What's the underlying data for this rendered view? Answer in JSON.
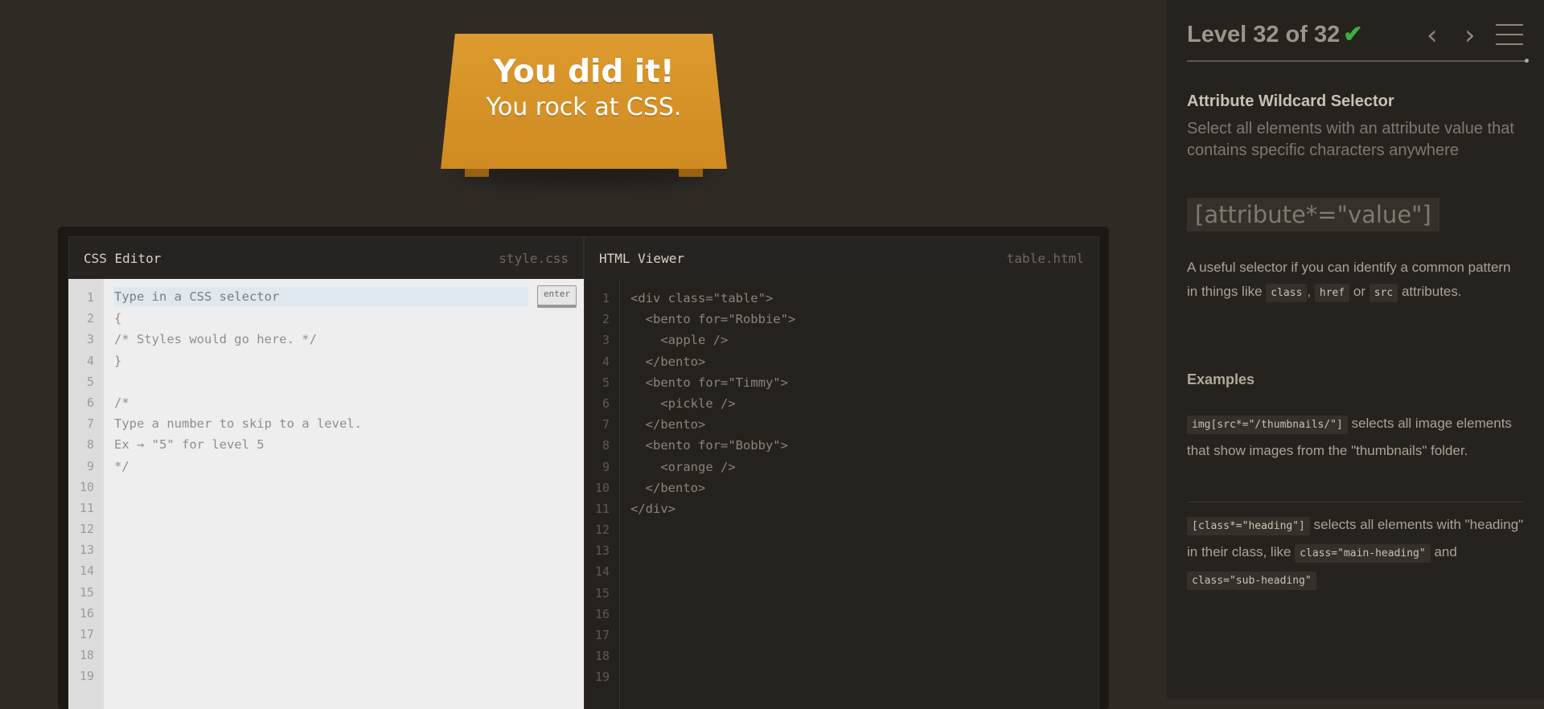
{
  "win": {
    "line1": "You did it!",
    "line2": "You rock at CSS."
  },
  "css_pane": {
    "title": "CSS Editor",
    "file": "style.css",
    "placeholder": "Type in a CSS selector",
    "enter_label": "enter",
    "lines": [
      "",
      "{",
      "/* Styles would go here. */",
      "}",
      "",
      "/*",
      "Type a number to skip to a level.",
      "Ex → \"5\" for level 5",
      "*/"
    ],
    "line_numbers": [
      "1",
      "2",
      "3",
      "4",
      "5",
      "6",
      "7",
      "8",
      "9",
      "10",
      "11",
      "12",
      "13",
      "14",
      "15",
      "16",
      "17",
      "18",
      "19"
    ]
  },
  "html_pane": {
    "title": "HTML Viewer",
    "file": "table.html",
    "lines": [
      "<div class=\"table\">",
      "  <bento for=\"Robbie\">",
      "    <apple />",
      "  </bento>",
      "  <bento for=\"Timmy\">",
      "    <pickle />",
      "  </bento>",
      "  <bento for=\"Bobby\">",
      "    <orange />",
      "  </bento>",
      "</div>"
    ],
    "line_numbers": [
      "1",
      "2",
      "3",
      "4",
      "5",
      "6",
      "7",
      "8",
      "9",
      "10",
      "11",
      "12",
      "13",
      "14",
      "15",
      "16",
      "17",
      "18",
      "19"
    ]
  },
  "sidebar": {
    "level_text": "Level 32 of 32",
    "check": "✔",
    "prev": "‹",
    "next": "›",
    "selector_name": "Attribute Wildcard Selector",
    "title": "Select all elements with an attribute value that contains specific characters anywhere",
    "syntax": "[attribute*=\"value\"]",
    "hint": {
      "before": "A useful selector if you can identify a common pattern in things like ",
      "tag1": "class",
      "sep1": ", ",
      "tag2": "href",
      "sep2": " or ",
      "tag3": "src",
      "after": " attributes."
    },
    "examples_title": "Examples",
    "example1": {
      "code": "img[src*=\"/thumbnails/\"]",
      "text": " selects all image elements that show images from the \"thumbnails\" folder."
    },
    "example2": {
      "code": "[class*=\"heading\"]",
      "text1": " selects all elements with \"heading\" in their class, like ",
      "code2": "class=\"main-heading\"",
      "text2": " and ",
      "code3": "class=\"sub-heading\""
    }
  }
}
